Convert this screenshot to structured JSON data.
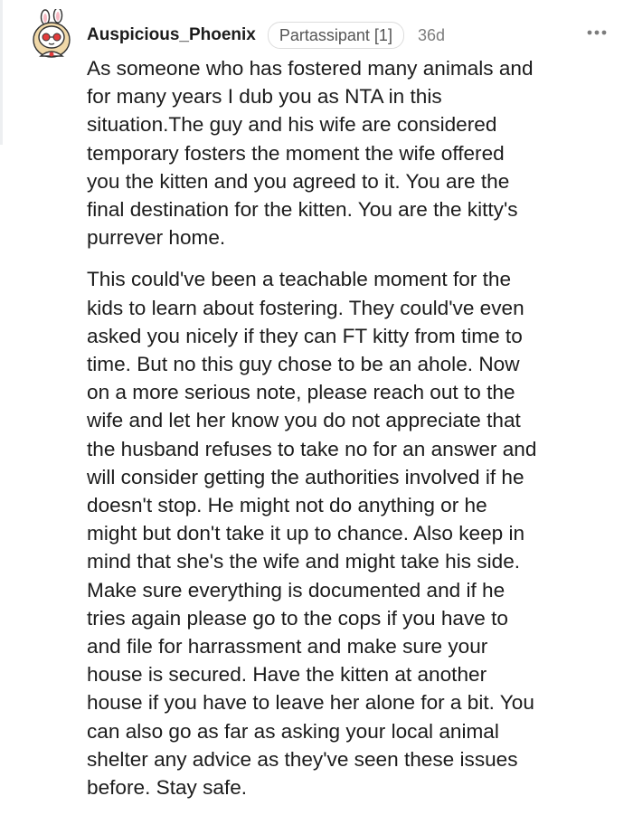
{
  "comment": {
    "username": "Auspicious_Phoenix",
    "flair": "Partassipant [1]",
    "age": "36d",
    "avatar_icon": "snoo-avatar-bunny-ears-icon",
    "more_icon": "more-options-icon",
    "paragraphs": [
      "As someone who has fostered many animals and\nfor many years I dub you as NTA in this\nsituation.The guy and his wife are considered\ntemporary fosters the moment the wife offered\nyou the kitten and you agreed to it. You are the\nfinal destination for the kitten. You are the kitty's\npurrever home.",
      "This could've been a teachable moment for the\nkids to learn about fostering. They could've even\nasked you nicely if they can FT kitty from time to\ntime. But no this guy chose to be an ahole. Now\non a more serious note, please reach out to the\nwife and let her know you do not appreciate that\nthe husband refuses to take no for an answer and\nwill consider getting the authorities involved if he\ndoesn't stop. He might not do anything or he\nmight but don't take it up to chance. Also keep in\nmind that she's the wife and might take his side.\nMake sure everything is documented and if he\ntries again please go to the cops if you have to\nand file for harrassment and make sure your\nhouse is secured. Have the kitten at another\nhouse if you have to leave her alone for a bit. You\ncan also go as far as asking your local animal\nshelter any advice as they've seen these issues\nbefore. Stay safe."
    ]
  },
  "colors": {
    "text": "#1c1c1c",
    "meta": "#7c7c7c",
    "flair_border": "#dcdcdc",
    "thread_line": "#edeff1"
  }
}
